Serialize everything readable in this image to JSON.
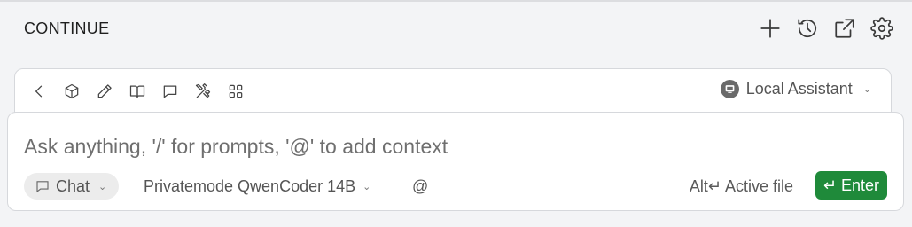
{
  "header": {
    "title": "CONTINUE",
    "actions": [
      {
        "name": "plus-icon"
      },
      {
        "name": "history-icon"
      },
      {
        "name": "open-external-icon"
      },
      {
        "name": "gear-icon"
      }
    ]
  },
  "toolbar": {
    "icons": [
      "chevron-left-icon",
      "cube-icon",
      "pencil-icon",
      "book-icon",
      "chat-bubble-icon",
      "tools-icon",
      "grid-icon"
    ],
    "assistant_label": "Local Assistant",
    "assistant_chevron": "⌄"
  },
  "input": {
    "placeholder": "Ask anything, '/' for prompts, '@' to add context",
    "mode_label": "Chat",
    "mode_chevron": "⌄",
    "model_label": "Privatemode QwenCoder 14B",
    "model_chevron": "⌄",
    "at_label": "@",
    "active_file_label": "Alt↵ Active file",
    "enter_label": "↵ Enter"
  },
  "colors": {
    "accent_green": "#1f8a3a",
    "background": "#f3f4f6"
  }
}
